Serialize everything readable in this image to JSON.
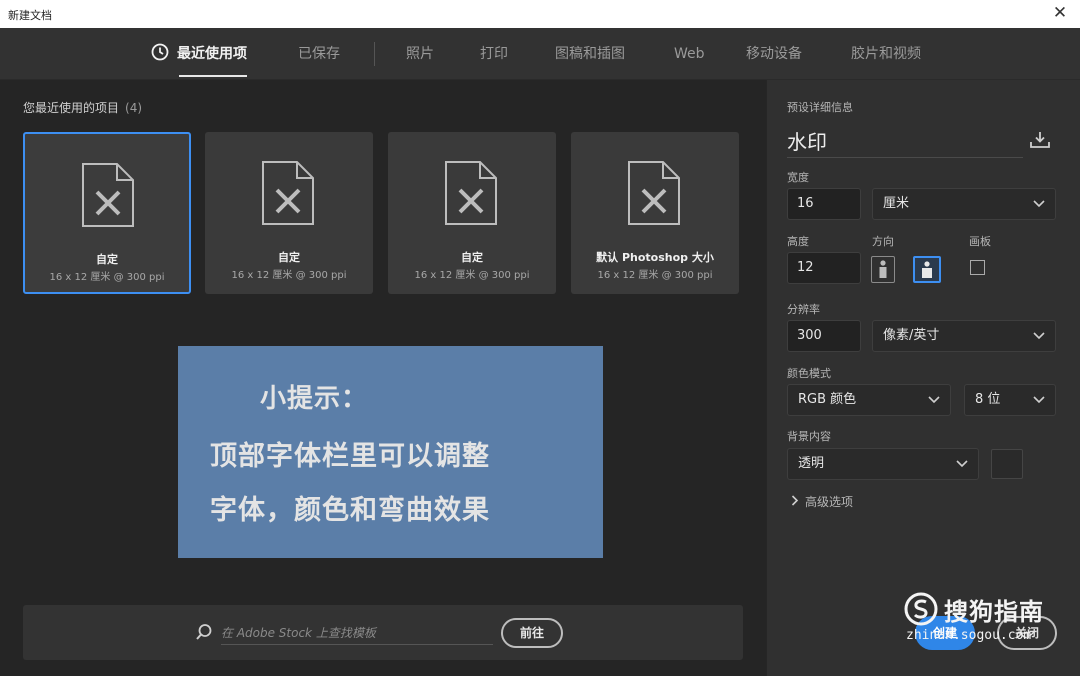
{
  "window": {
    "title": "新建文档",
    "close_glyph": "✕"
  },
  "tabs": [
    {
      "label": "最近使用项",
      "active": true
    },
    {
      "label": "已保存"
    },
    {
      "label": "照片"
    },
    {
      "label": "打印"
    },
    {
      "label": "图稿和插图"
    },
    {
      "label": "Web"
    },
    {
      "label": "移动设备"
    },
    {
      "label": "胶片和视频"
    }
  ],
  "recent": {
    "title": "您最近使用的项目",
    "count": "(4)",
    "items": [
      {
        "name": "自定",
        "dims": "16 x 12 厘米 @ 300 ppi",
        "selected": true
      },
      {
        "name": "自定",
        "dims": "16 x 12 厘米 @ 300 ppi"
      },
      {
        "name": "自定",
        "dims": "16 x 12 厘米 @ 300 ppi"
      },
      {
        "name": "默认 Photoshop 大小",
        "dims": "16 x 12 厘米 @ 300 ppi"
      }
    ]
  },
  "tip": {
    "line1": "小提示：",
    "line2": "顶部字体栏里可以调整",
    "line3": "字体，颜色和弯曲效果"
  },
  "stock": {
    "placeholder": "在 Adobe Stock 上查找模板",
    "go_label": "前往"
  },
  "preset": {
    "section_label": "预设详细信息",
    "name": "水印",
    "width_label": "宽度",
    "width": "16",
    "width_unit": "厘米",
    "height_label": "高度",
    "height": "12",
    "orientation_label": "方向",
    "artboard_label": "画板",
    "resolution_label": "分辨率",
    "resolution": "300",
    "resolution_unit": "像素/英寸",
    "color_mode_label": "颜色模式",
    "color_mode": "RGB 颜色",
    "bit_depth": "8 位",
    "background_label": "背景内容",
    "background": "透明",
    "advanced_label": "高级选项"
  },
  "actions": {
    "create_label": "创建",
    "close_label": "关闭"
  },
  "watermark": {
    "brand": "搜狗指南",
    "url": "zhinan.sogou.com"
  },
  "colors": {
    "accent": "#3d8ff2",
    "tip_bg": "#5b7ea8",
    "create_bg": "#2f86e8"
  }
}
